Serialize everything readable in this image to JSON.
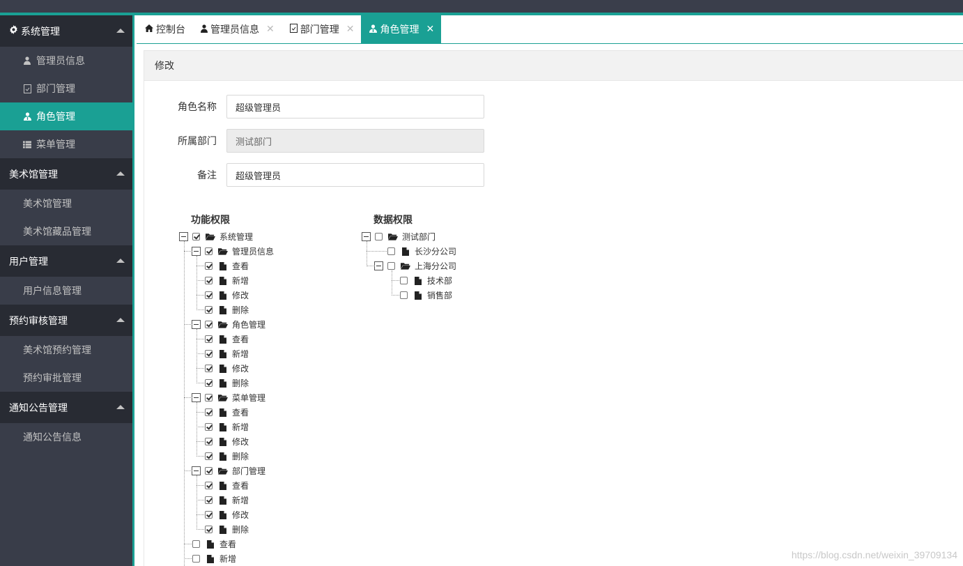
{
  "sidebar": {
    "groups": [
      {
        "label": "系统管理",
        "icon": "gear-icon",
        "items": [
          {
            "label": "管理员信息",
            "icon": "user-icon",
            "active": false
          },
          {
            "label": "部门管理",
            "icon": "file-icon",
            "active": false
          },
          {
            "label": "角色管理",
            "icon": "user-group-icon",
            "active": true
          },
          {
            "label": "菜单管理",
            "icon": "list-icon",
            "active": false
          }
        ]
      },
      {
        "label": "美术馆管理",
        "items": [
          {
            "label": "美术馆管理"
          },
          {
            "label": "美术馆藏品管理"
          }
        ]
      },
      {
        "label": "用户管理",
        "items": [
          {
            "label": "用户信息管理"
          }
        ]
      },
      {
        "label": "预约审核管理",
        "items": [
          {
            "label": "美术馆预约管理"
          },
          {
            "label": "预约审批管理"
          }
        ]
      },
      {
        "label": "通知公告管理",
        "items": [
          {
            "label": "通知公告信息"
          }
        ]
      }
    ]
  },
  "tabs": [
    {
      "label": "控制台",
      "icon": "home-icon",
      "closable": false,
      "active": false
    },
    {
      "label": "管理员信息",
      "icon": "user-icon",
      "closable": true,
      "active": false
    },
    {
      "label": "部门管理",
      "icon": "file-icon",
      "closable": true,
      "active": false
    },
    {
      "label": "角色管理",
      "icon": "user-group-icon",
      "closable": true,
      "active": true
    }
  ],
  "panel": {
    "title": "修改"
  },
  "form": {
    "role_name": {
      "label": "角色名称",
      "value": "超级管理员"
    },
    "department": {
      "label": "所属部门",
      "value": "测试部门"
    },
    "remark": {
      "label": "备注",
      "value": "超级管理员"
    }
  },
  "func_perm": {
    "title": "功能权限",
    "root": {
      "label": "系统管理",
      "checked": true
    },
    "modules": [
      {
        "label": "管理员信息",
        "checked": true,
        "actions": [
          {
            "label": "查看",
            "checked": true
          },
          {
            "label": "新增",
            "checked": true
          },
          {
            "label": "修改",
            "checked": true
          },
          {
            "label": "删除",
            "checked": true
          }
        ]
      },
      {
        "label": "角色管理",
        "checked": true,
        "actions": [
          {
            "label": "查看",
            "checked": true
          },
          {
            "label": "新增",
            "checked": true
          },
          {
            "label": "修改",
            "checked": true
          },
          {
            "label": "删除",
            "checked": true
          }
        ]
      },
      {
        "label": "菜单管理",
        "checked": true,
        "actions": [
          {
            "label": "查看",
            "checked": true
          },
          {
            "label": "新增",
            "checked": true
          },
          {
            "label": "修改",
            "checked": true
          },
          {
            "label": "删除",
            "checked": true
          }
        ]
      },
      {
        "label": "部门管理",
        "checked": true,
        "actions": [
          {
            "label": "查看",
            "checked": true
          },
          {
            "label": "新增",
            "checked": true
          },
          {
            "label": "修改",
            "checked": true
          },
          {
            "label": "删除",
            "checked": true
          }
        ]
      }
    ],
    "root_actions": [
      {
        "label": "查看",
        "checked": false
      },
      {
        "label": "新增",
        "checked": false
      }
    ]
  },
  "data_perm": {
    "title": "数据权限",
    "root": {
      "label": "测试部门",
      "checked": false
    },
    "children": [
      {
        "label": "长沙分公司",
        "checked": false
      },
      {
        "label": "上海分公司",
        "checked": false,
        "children": [
          {
            "label": "技术部",
            "checked": false
          },
          {
            "label": "销售部",
            "checked": false
          }
        ]
      }
    ]
  },
  "watermark": "https://blog.csdn.net/weixin_39709134",
  "colors": {
    "accent": "#1aa094",
    "sidebar_bg": "#393d49",
    "sidebar_head": "#282b33"
  }
}
